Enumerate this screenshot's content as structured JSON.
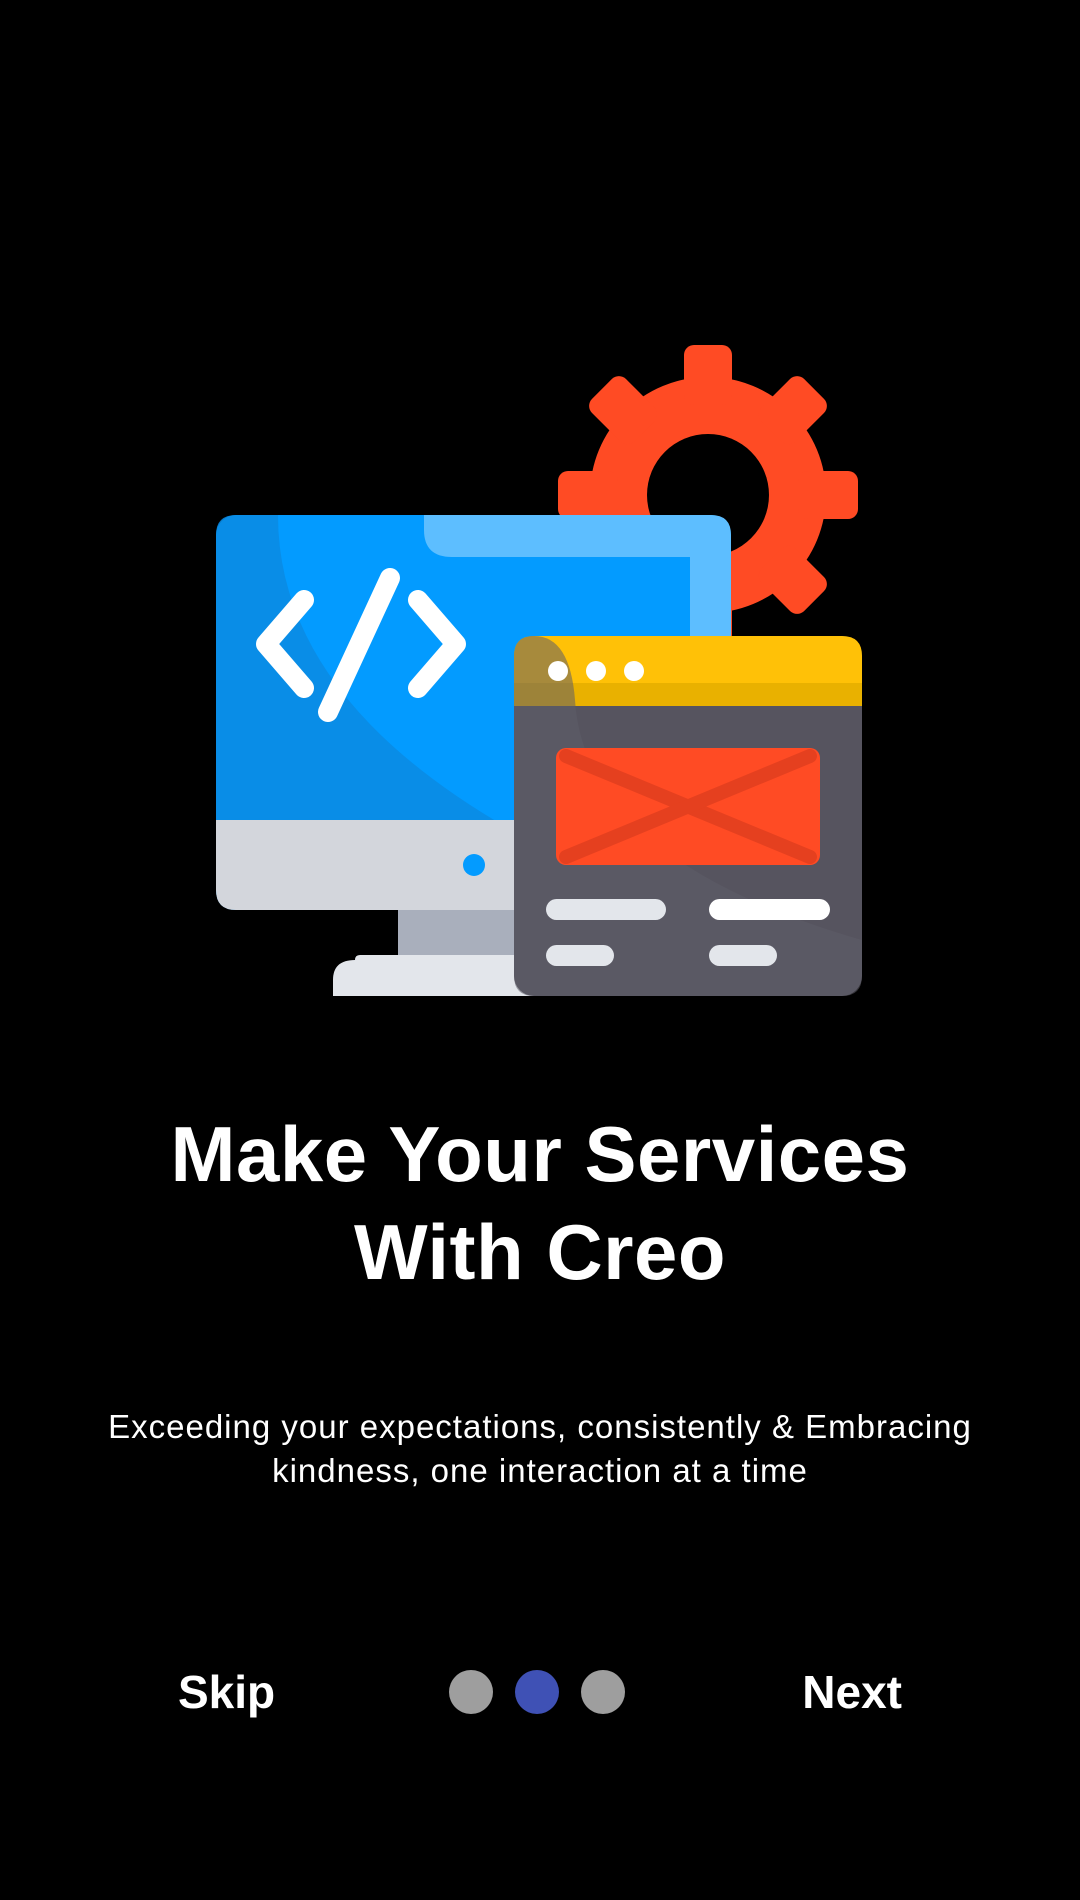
{
  "onboarding": {
    "title_line1": "Make Your Services",
    "title_line2": "With Creo",
    "subtitle_line1": "Exceeding your expectations, consistently & Embracing",
    "subtitle_line2": "kindness, one interaction at a time",
    "illustration_icon": "web-development-illustration",
    "code_symbol": "</>"
  },
  "nav": {
    "skip_label": "Skip",
    "next_label": "Next",
    "page_count": 3,
    "active_page": 2
  },
  "colors": {
    "background": "#000000",
    "monitor_blue": "#039BFF",
    "gear_orange": "#FF4B24",
    "window_header_yellow": "#FFC107",
    "window_body_gray": "#56545F",
    "dot_active": "#3F51B5",
    "dot_inactive": "#9E9E9E"
  }
}
